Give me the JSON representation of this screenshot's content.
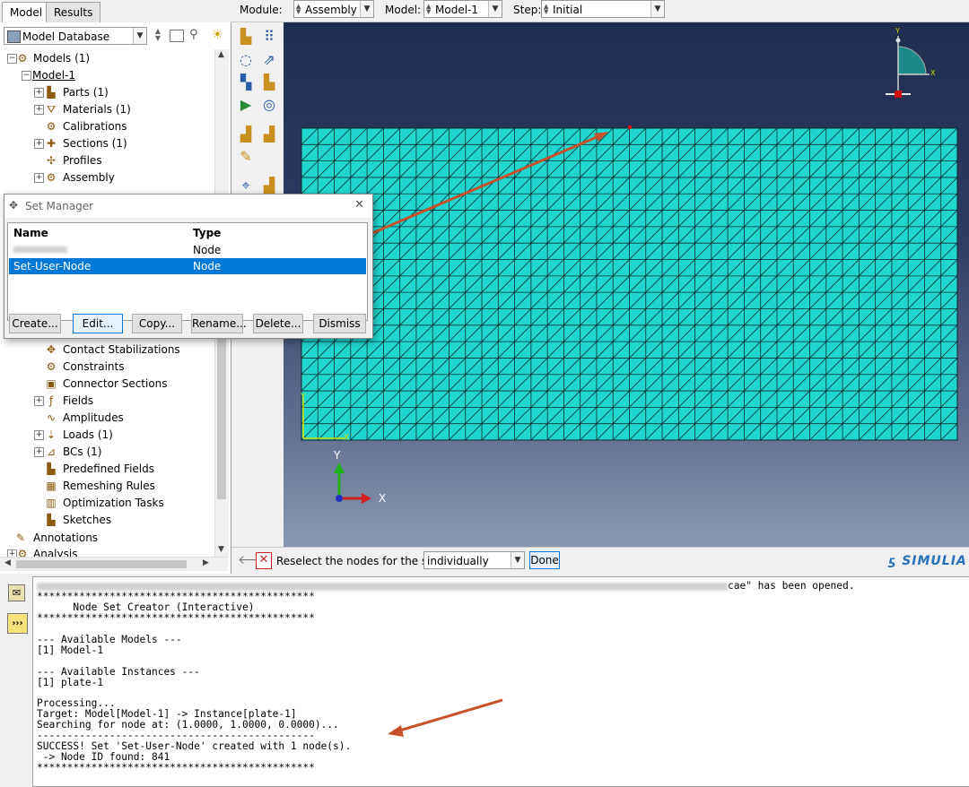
{
  "tabs": [
    "Model",
    "Results"
  ],
  "context_bar": {
    "module_label": "Module:",
    "module_value": "Assembly",
    "model_label": "Model:",
    "model_value": "Model-1",
    "step_label": "Step:",
    "step_value": "Initial"
  },
  "tree": {
    "db_label": "Model Database",
    "items": [
      "Models (1)",
      "Model-1",
      "Parts (1)",
      "Materials (1)",
      "Calibrations",
      "Sections (1)",
      "Profiles",
      "Assembly",
      "Contact Stabilizations",
      "Constraints",
      "Connector Sections",
      "Fields",
      "Amplitudes",
      "Loads (1)",
      "BCs (1)",
      "Predefined Fields",
      "Remeshing Rules",
      "Optimization Tasks",
      "Sketches",
      "Annotations",
      "Analysis"
    ]
  },
  "set_manager": {
    "title": "Set Manager",
    "col_name": "Name",
    "col_type": "Type",
    "rows": [
      {
        "name": "",
        "type": "Node"
      },
      {
        "name": "Set-User-Node",
        "type": "Node"
      }
    ],
    "buttons": [
      "Create...",
      "Edit...",
      "Copy...",
      "Rename...",
      "Delete...",
      "Dismiss"
    ]
  },
  "triad": {
    "y": "Y",
    "x": "X"
  },
  "mini_triad": {
    "y": "Y",
    "x": "X"
  },
  "prompt": {
    "text": "Reselect the nodes for the set",
    "select_value": "individually",
    "done_label": "Done",
    "brand": "SIMULIA"
  },
  "message_lines": [
    "cae\" has been opened.",
    "**********************************************",
    "      Node Set Creator (Interactive)",
    "**********************************************",
    "",
    "--- Available Models ---",
    "[1] Model-1",
    "",
    "--- Available Instances ---",
    "[1] plate-1",
    "",
    "Processing...",
    "Target: Model[Model-1] -> Instance[plate-1]",
    "Searching for node at: (1.0000, 1.0000, 0.0000)...",
    "----------------------------------------------",
    "SUCCESS! Set 'Set-User-Node' created with 1 node(s).",
    " -> Node ID found: 841",
    "**********************************************"
  ],
  "colors": {
    "mesh": "#1fd6cf",
    "viewport_top": "#1f2e4e",
    "selection": "#0078d7",
    "annotation_arrow": "#c8502a"
  }
}
